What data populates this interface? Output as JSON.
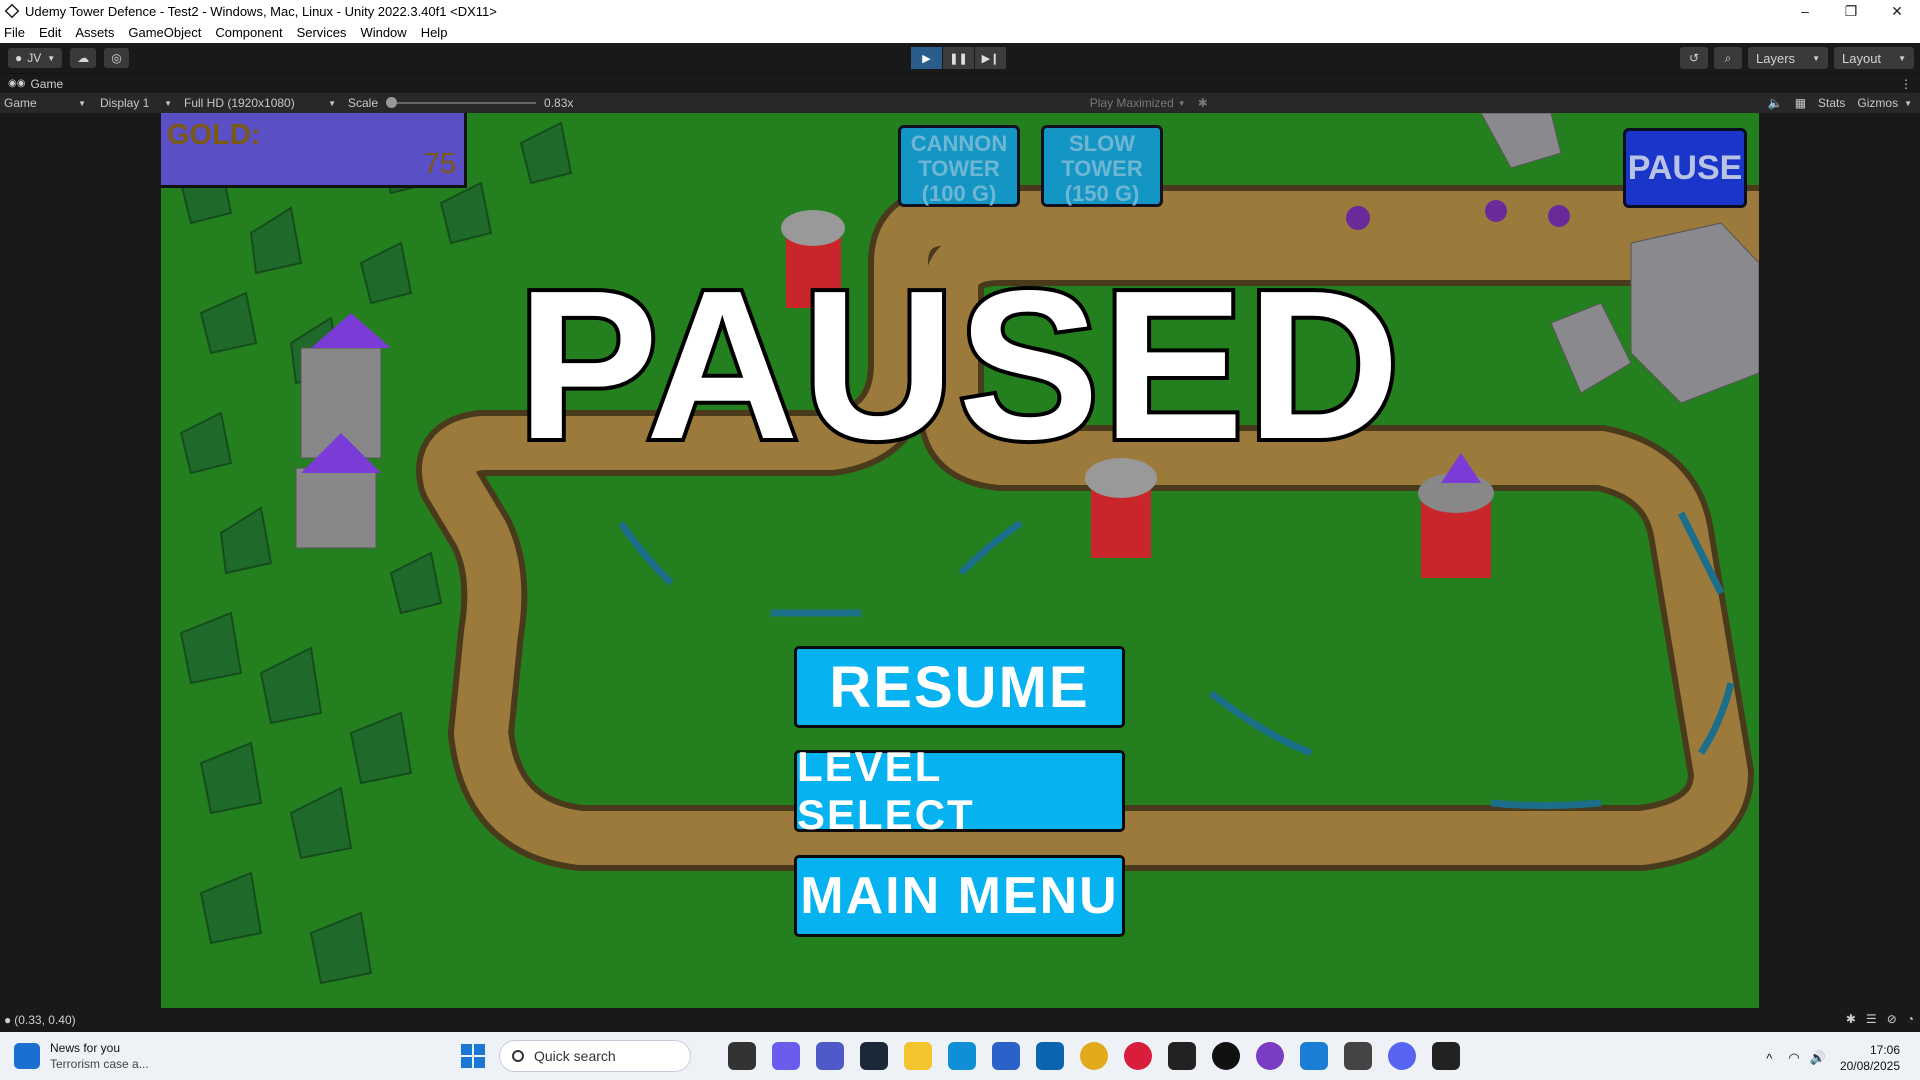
{
  "window": {
    "title": "Udemy Tower Defence - Test2 - Windows, Mac, Linux - Unity 2022.3.40f1 <DX11>",
    "minimize": "–",
    "restore": "❐",
    "close": "✕"
  },
  "menu": [
    "File",
    "Edit",
    "Assets",
    "GameObject",
    "Component",
    "Services",
    "Window",
    "Help"
  ],
  "toolbar": {
    "account": "JV",
    "layers": "Layers",
    "layout": "Layout"
  },
  "tab": {
    "label": "Game"
  },
  "gamebar": {
    "view": "Game",
    "display": "Display 1",
    "resolution": "Full HD (1920x1080)",
    "scale_label": "Scale",
    "scale_value": "0.83x",
    "play_mode": "Play Maximized",
    "stats": "Stats",
    "gizmos": "Gizmos"
  },
  "hud": {
    "gold_label": "GOLD:",
    "gold_value": "75",
    "cannon_tower": "CANNON TOWER (100 G)",
    "slow_tower": "SLOW TOWER (150 G)",
    "pause": "PAUSE"
  },
  "pause_menu": {
    "title": "PAUSED",
    "resume": "RESUME",
    "level_select": "LEVEL SELECT",
    "main_menu": "MAIN MENU"
  },
  "status": {
    "text": "(0.33, 0.40)"
  },
  "taskbar": {
    "news_title": "News for you",
    "news_sub": "Terrorism case a...",
    "search_placeholder": "Quick search",
    "time": "17:06",
    "date": "20/08/2025"
  },
  "colors": {
    "grass": "#24801e",
    "path": "#9c7a3c",
    "ui_button": "#07b2f0",
    "gold_panel": "#5a4fc4",
    "pause_button": "#1a36c8"
  }
}
